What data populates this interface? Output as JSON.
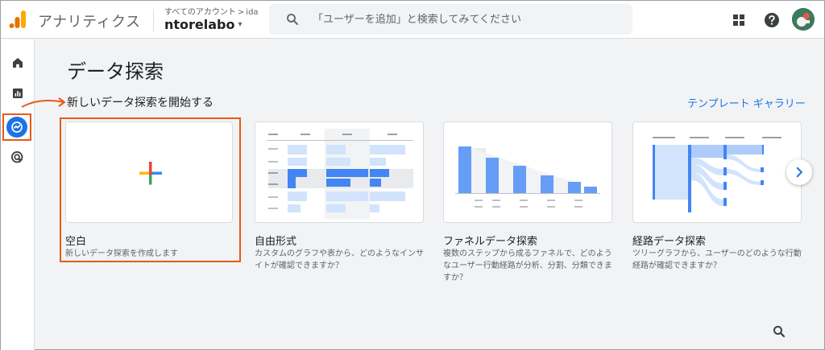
{
  "header": {
    "app_title": "アナリティクス",
    "breadcrumb_all": "すべてのアカウント",
    "breadcrumb_sep": ">",
    "breadcrumb_account": "ida",
    "property_name": "ntorelabo",
    "property_caret": "▾",
    "search_placeholder": "「ユーザーを追加」と検索してみてください",
    "icons": [
      "analytics-logo",
      "search-icon",
      "apps-grid-icon",
      "help-icon",
      "avatar"
    ]
  },
  "sidebar": {
    "items": [
      {
        "icon": "home-icon"
      },
      {
        "icon": "reports-icon"
      },
      {
        "icon": "explore-icon",
        "active": true
      },
      {
        "icon": "advertising-icon"
      }
    ]
  },
  "main": {
    "page_title": "データ探索",
    "section_title": "新しいデータ探索を開始する",
    "gallery_link": "テンプレート ギャラリー",
    "cards": [
      {
        "name": "空白",
        "desc": "新しいデータ探索を作成します"
      },
      {
        "name": "自由形式",
        "desc": "カスタムのグラフや表から、どのようなインサイトが確認できますか？"
      },
      {
        "name": "ファネルデータ探索",
        "desc": "複数のステップから成るファネルで、どのようなユーザー行動経路が分析、分割、分類できますか？"
      },
      {
        "name": "経路データ探索",
        "desc": "ツリーグラフから、ユーザーのどのような行動経路が確認できますか？"
      }
    ]
  },
  "colors": {
    "accent_blue": "#1a73e8",
    "highlight_orange": "#e8591a",
    "thumb_blue": "#aecbfa",
    "thumb_blue_dark": "#4285f4"
  }
}
